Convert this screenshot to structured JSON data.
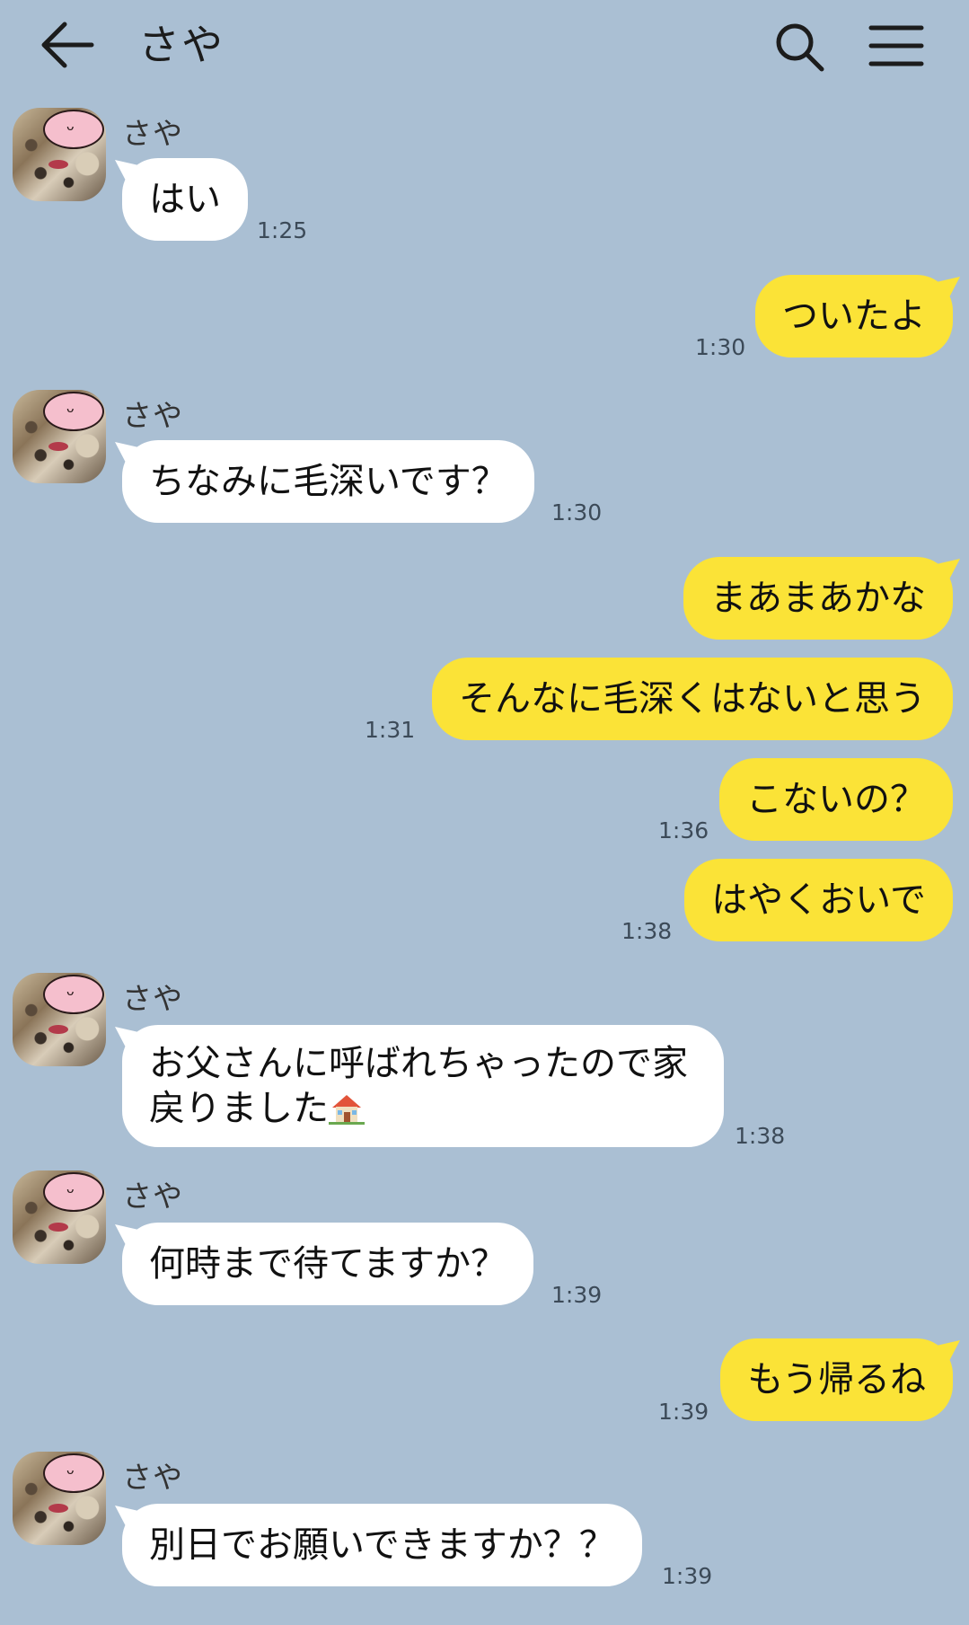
{
  "header": {
    "title": "さや"
  },
  "messages": [
    {
      "direction": "in",
      "sender": "さや",
      "text": "はい",
      "time": "1:25"
    },
    {
      "direction": "out",
      "text": "ついたよ",
      "time": "1:30"
    },
    {
      "direction": "in",
      "sender": "さや",
      "text": "ちなみに毛深いです？",
      "time": "1:30"
    },
    {
      "direction": "out",
      "text": "まあまあかな",
      "time": ""
    },
    {
      "direction": "out",
      "text": "そんなに毛深くはないと思う",
      "time": "1:31"
    },
    {
      "direction": "out",
      "text": "こないの？",
      "time": "1:36"
    },
    {
      "direction": "out",
      "text": "はやくおいで",
      "time": "1:38"
    },
    {
      "direction": "in",
      "sender": "さや",
      "text_line1": "お父さんに呼ばれちゃったので家",
      "text_line2": "戻りました",
      "emoji": "house-icon",
      "time": "1:38"
    },
    {
      "direction": "in",
      "sender": "さや",
      "text": "何時まで待てますか？",
      "time": "1:39"
    },
    {
      "direction": "out",
      "text": "もう帰るね",
      "time": "1:39"
    },
    {
      "direction": "in",
      "sender": "さや",
      "text": "別日でお願いできますか？？",
      "time": "1:39"
    }
  ],
  "colors": {
    "background": "#aabfd3",
    "incoming_bubble": "#ffffff",
    "outgoing_bubble": "#fbe337"
  }
}
